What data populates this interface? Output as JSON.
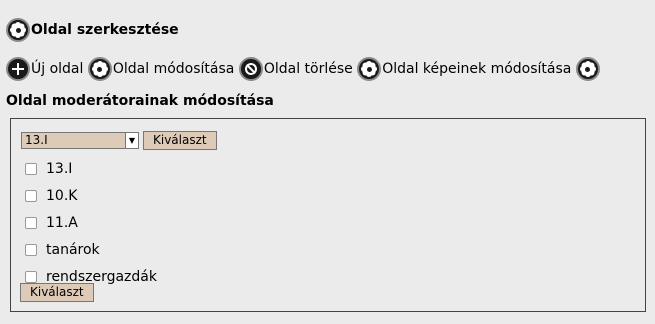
{
  "page": {
    "title": "Oldal szerkesztése",
    "title_icon": "gear-icon"
  },
  "actions": [
    {
      "label": "Új oldal",
      "icon": "plus-icon"
    },
    {
      "label": "Oldal módosítása",
      "icon": "gear-icon"
    },
    {
      "label": "Oldal törlése",
      "icon": "ban-icon"
    },
    {
      "label": "Oldal képeinek módosítása",
      "icon": "gear-icon"
    }
  ],
  "moderators": {
    "icon": "gear-icon",
    "label": "Oldal moderátorainak módosítása"
  },
  "form": {
    "select_value": "13.I",
    "select_button": "Kiválaszt",
    "checkboxes": [
      {
        "label": "13.I",
        "checked": false
      },
      {
        "label": "10.K",
        "checked": false
      },
      {
        "label": "11.A",
        "checked": false
      },
      {
        "label": "tanárok",
        "checked": false
      },
      {
        "label": "rendszergazdák",
        "checked": false
      }
    ],
    "submit_button": "Kiválaszt"
  },
  "colors": {
    "background": "#ebebeb",
    "button_bg": "#decbb7",
    "icon_dark": "#1a1a1a"
  }
}
